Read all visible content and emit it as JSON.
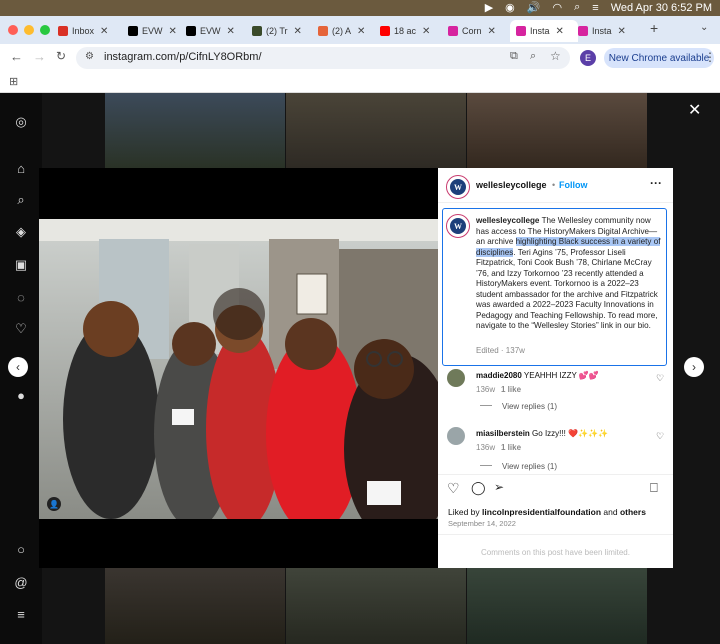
{
  "menubar": {
    "datetime": "Wed Apr 30  6:52 PM"
  },
  "tabs": [
    {
      "label": "Inbox",
      "favicon": "gmail-icon",
      "color": "#d93025"
    },
    {
      "label": "EVW",
      "favicon": "x-icon",
      "color": "#000000"
    },
    {
      "label": "EVW",
      "favicon": "x-icon",
      "color": "#000000"
    },
    {
      "label": "(2) Tr",
      "favicon": "app-icon",
      "color": "#3a4a2a"
    },
    {
      "label": "(2) A",
      "favicon": "app-icon",
      "color": "#e5643a"
    },
    {
      "label": "18 ac",
      "favicon": "youtube-icon",
      "color": "#ff0000"
    },
    {
      "label": "Corn",
      "favicon": "instagram-icon",
      "color": "#d6249f"
    },
    {
      "label": "Insta",
      "favicon": "instagram-icon",
      "color": "#d6249f"
    },
    {
      "label": "Insta",
      "favicon": "instagram-icon",
      "color": "#d6249f"
    }
  ],
  "toolbar": {
    "url": "instagram.com/p/CifnLY8ORbm/",
    "new_chrome": "New Chrome available",
    "profile_initial": "E"
  },
  "post": {
    "username": "wellesleycollege",
    "follow": "Follow",
    "caption_user": "wellesleycollege",
    "caption_pre": "The Wellesley community now has access to The HistoryMakers Digital Archive—an archive ",
    "caption_highlight": "highlighting Black success in a variety of disciplines",
    "caption_post": ". Teri Agins ’75, Professor Liseli Fitzpatrick, Toni Cook Bush ’78, Chirlane McCray ’76, and Izzy Torkornoo ’23 recently attended a HistoryMakers event. Torkornoo is a 2022–23 student ambassador for the archive and Fitzpatrick was awarded a 2022–2023 Faculty Innovations in Pedagogy and Teaching Fellowship. To read more, navigate to the “Wellesley Stories” link in our bio.",
    "edited": "Edited · 137w",
    "comments": [
      {
        "user": "maddie2080",
        "text": "YEAHHH IZZY 💕💕",
        "age": "136w",
        "likes": "1 like",
        "replies": "View replies (1)"
      },
      {
        "user": "miasilberstein",
        "text": "Go Izzy!!! ❤️✨✨✨",
        "age": "136w",
        "likes": "1 like",
        "replies": "View replies (1)"
      }
    ],
    "liked_by_prefix": "Liked by ",
    "liked_by_user": "lincolnpresidentialfoundation",
    "liked_by_and": " and ",
    "liked_by_others": "others",
    "date": "September 14, 2022",
    "comments_limited": "Comments on this post have been limited."
  },
  "colors": {
    "accent": "#0095f6",
    "modal_border": "#1a73e8"
  }
}
